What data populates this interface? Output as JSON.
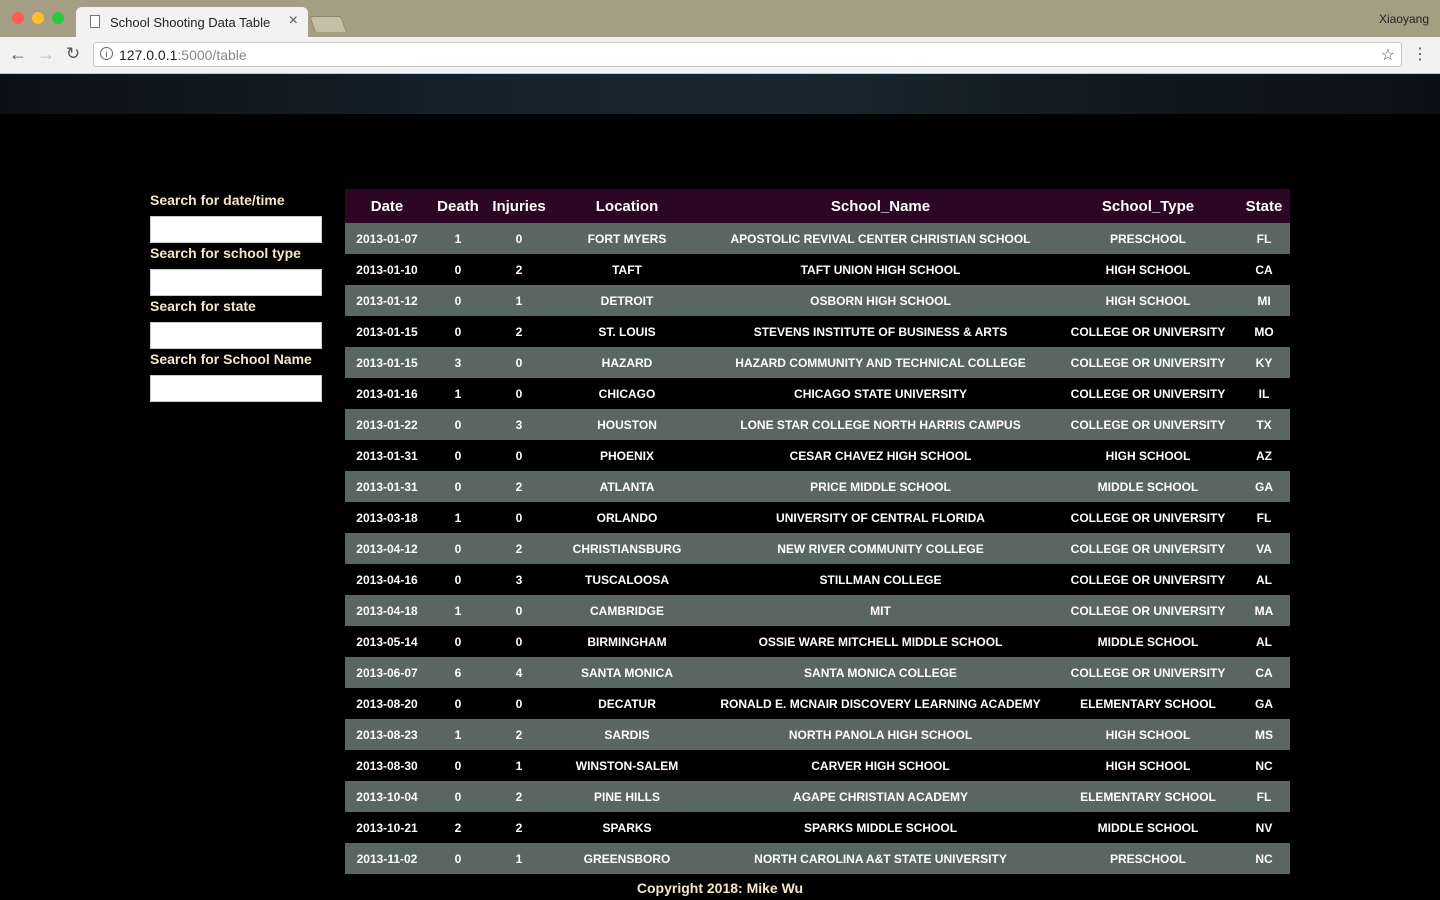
{
  "browser": {
    "tab_title": "School Shooting Data Table",
    "profile_name": "Xiaoyang",
    "url_host": "127.0.0.1",
    "url_rest": ":5000/table",
    "icons": [
      "page-icon",
      "close-icon",
      "back-icon",
      "forward-icon",
      "reload-icon",
      "info-icon",
      "star-icon",
      "menu-icon"
    ]
  },
  "sidebar": {
    "labels": [
      "Search for date/time",
      "Search for school type",
      "Search for state",
      "Search for School Name"
    ]
  },
  "table": {
    "headers": [
      "Date",
      "Death",
      "Injuries",
      "Location",
      "School_Name",
      "School_Type",
      "State"
    ],
    "rows": [
      [
        "2013-01-07",
        "1",
        "0",
        "FORT MYERS",
        "APOSTOLIC REVIVAL CENTER CHRISTIAN SCHOOL",
        "PRESCHOOL",
        "FL"
      ],
      [
        "2013-01-10",
        "0",
        "2",
        "TAFT",
        "TAFT UNION HIGH SCHOOL",
        "HIGH SCHOOL",
        "CA"
      ],
      [
        "2013-01-12",
        "0",
        "1",
        "DETROIT",
        "OSBORN HIGH SCHOOL",
        "HIGH SCHOOL",
        "MI"
      ],
      [
        "2013-01-15",
        "0",
        "2",
        "ST. LOUIS",
        "STEVENS INSTITUTE OF BUSINESS & ARTS",
        "COLLEGE OR UNIVERSITY",
        "MO"
      ],
      [
        "2013-01-15",
        "3",
        "0",
        "HAZARD",
        "HAZARD COMMUNITY AND TECHNICAL COLLEGE",
        "COLLEGE OR UNIVERSITY",
        "KY"
      ],
      [
        "2013-01-16",
        "1",
        "0",
        "CHICAGO",
        "CHICAGO STATE UNIVERSITY",
        "COLLEGE OR UNIVERSITY",
        "IL"
      ],
      [
        "2013-01-22",
        "0",
        "3",
        "HOUSTON",
        "LONE STAR COLLEGE NORTH HARRIS CAMPUS",
        "COLLEGE OR UNIVERSITY",
        "TX"
      ],
      [
        "2013-01-31",
        "0",
        "0",
        "PHOENIX",
        "CESAR CHAVEZ HIGH SCHOOL",
        "HIGH SCHOOL",
        "AZ"
      ],
      [
        "2013-01-31",
        "0",
        "2",
        "ATLANTA",
        "PRICE MIDDLE SCHOOL",
        "MIDDLE SCHOOL",
        "GA"
      ],
      [
        "2013-03-18",
        "1",
        "0",
        "ORLANDO",
        "UNIVERSITY OF CENTRAL FLORIDA",
        "COLLEGE OR UNIVERSITY",
        "FL"
      ],
      [
        "2013-04-12",
        "0",
        "2",
        "CHRISTIANSBURG",
        "NEW RIVER COMMUNITY COLLEGE",
        "COLLEGE OR UNIVERSITY",
        "VA"
      ],
      [
        "2013-04-16",
        "0",
        "3",
        "TUSCALOOSA",
        "STILLMAN COLLEGE",
        "COLLEGE OR UNIVERSITY",
        "AL"
      ],
      [
        "2013-04-18",
        "1",
        "0",
        "CAMBRIDGE",
        "MIT",
        "COLLEGE OR UNIVERSITY",
        "MA"
      ],
      [
        "2013-05-14",
        "0",
        "0",
        "BIRMINGHAM",
        "OSSIE WARE MITCHELL MIDDLE SCHOOL",
        "MIDDLE SCHOOL",
        "AL"
      ],
      [
        "2013-06-07",
        "6",
        "4",
        "SANTA MONICA",
        "SANTA MONICA COLLEGE",
        "COLLEGE OR UNIVERSITY",
        "CA"
      ],
      [
        "2013-08-20",
        "0",
        "0",
        "DECATUR",
        "RONALD E. MCNAIR DISCOVERY LEARNING ACADEMY",
        "ELEMENTARY SCHOOL",
        "GA"
      ],
      [
        "2013-08-23",
        "1",
        "2",
        "SARDIS",
        "NORTH PANOLA HIGH SCHOOL",
        "HIGH SCHOOL",
        "MS"
      ],
      [
        "2013-08-30",
        "0",
        "1",
        "WINSTON-SALEM",
        "CARVER HIGH SCHOOL",
        "HIGH SCHOOL",
        "NC"
      ],
      [
        "2013-10-04",
        "0",
        "2",
        "PINE HILLS",
        "AGAPE CHRISTIAN ACADEMY",
        "ELEMENTARY SCHOOL",
        "FL"
      ],
      [
        "2013-10-21",
        "2",
        "2",
        "SPARKS",
        "SPARKS MIDDLE SCHOOL",
        "MIDDLE SCHOOL",
        "NV"
      ],
      [
        "2013-11-02",
        "0",
        "1",
        "GREENSBORO",
        "NORTH CAROLINA A&T STATE UNIVERSITY",
        "PRESCHOOL",
        "NC"
      ]
    ]
  },
  "footer": {
    "text": "Copyright 2018: Mike Wu"
  },
  "colors": {
    "header_bg": "#2d0625",
    "row_alt": "#5a6661",
    "label_text": "#f5e6c8"
  }
}
